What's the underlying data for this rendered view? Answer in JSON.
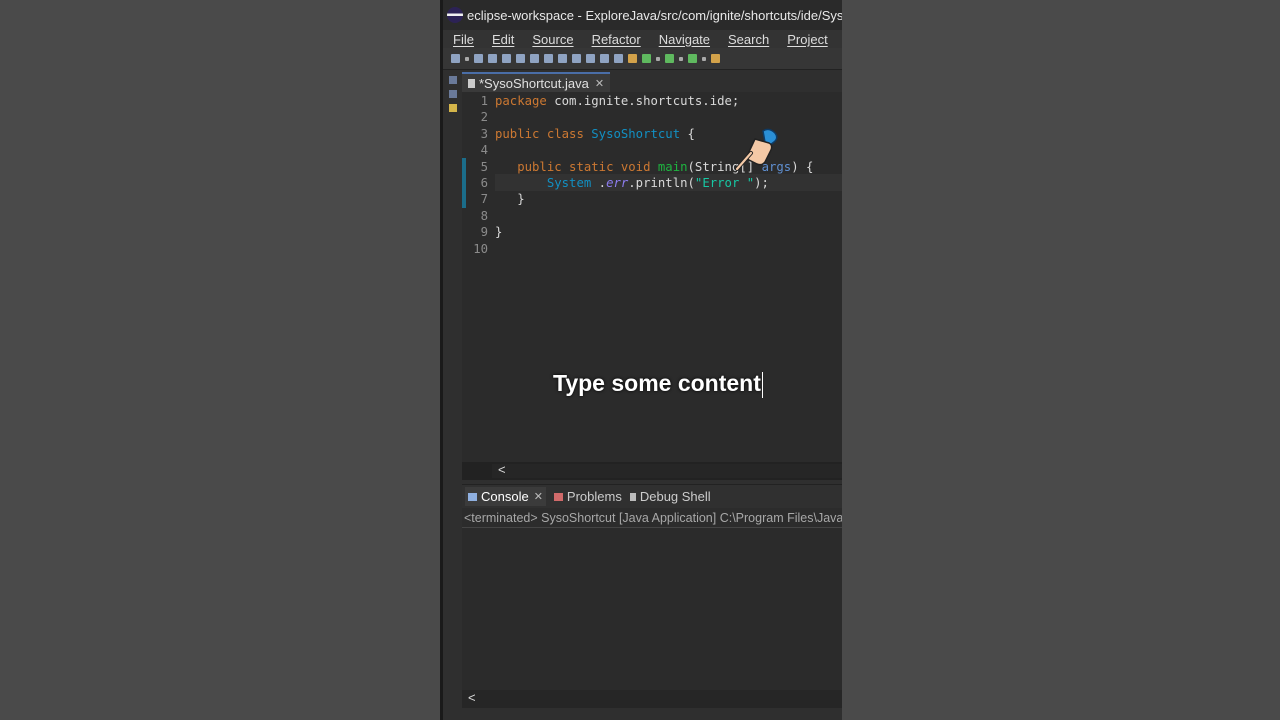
{
  "window": {
    "title": "eclipse-workspace - ExploreJava/src/com/ignite/shortcuts/ide/SysoS"
  },
  "menu": [
    "File",
    "Edit",
    "Source",
    "Refactor",
    "Navigate",
    "Search",
    "Project"
  ],
  "editor": {
    "tab_label": "*SysoShortcut.java",
    "lines": [
      {
        "n": "1",
        "parts": [
          [
            "kw",
            "package"
          ],
          [
            "",
            "com.ignite.shortcuts.ide;"
          ]
        ]
      },
      {
        "n": "2",
        "parts": []
      },
      {
        "n": "3",
        "parts": [
          [
            "kw",
            "public"
          ],
          [
            "kw",
            "class"
          ],
          [
            "cls",
            "SysoShortcut"
          ],
          [
            "",
            "{"
          ]
        ]
      },
      {
        "n": "4",
        "parts": []
      },
      {
        "n": "5",
        "parts": [
          [
            "",
            "   "
          ],
          [
            "kw",
            "public"
          ],
          [
            "kw",
            "static"
          ],
          [
            "kw",
            "void"
          ],
          [
            "mth",
            "main"
          ],
          [
            "",
            "(String[] "
          ],
          [
            "typ",
            "args"
          ],
          [
            "",
            ") {"
          ]
        ]
      },
      {
        "n": "6",
        "parts": [
          [
            "",
            "       "
          ],
          [
            "cls",
            "System"
          ],
          [
            "",
            "."
          ],
          [
            "fld",
            "err"
          ],
          [
            "",
            ".println("
          ],
          [
            "str",
            "\"Error \""
          ],
          [
            "",
            ");"
          ]
        ]
      },
      {
        "n": "7",
        "parts": [
          [
            "",
            "   }"
          ]
        ]
      },
      {
        "n": "8",
        "parts": []
      },
      {
        "n": "9",
        "parts": [
          [
            "",
            "}"
          ]
        ]
      },
      {
        "n": "10",
        "parts": []
      }
    ]
  },
  "console": {
    "tabs": [
      "Console",
      "Problems",
      "Debug Shell"
    ],
    "description": "<terminated> SysoShortcut [Java Application] C:\\Program Files\\Java\\"
  },
  "overlay": {
    "text": "Type some content"
  }
}
